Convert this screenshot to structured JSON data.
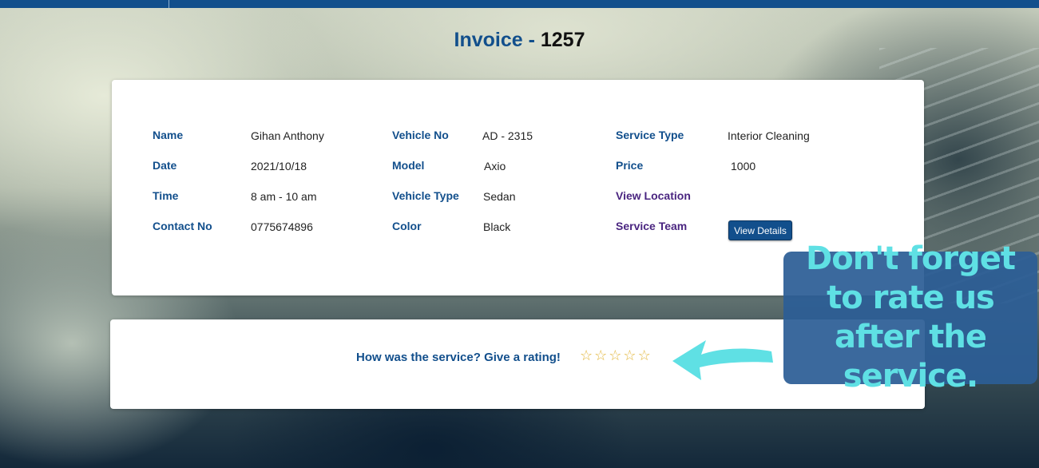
{
  "header": {
    "title_prefix": "Invoice - ",
    "invoice_number": "1257"
  },
  "details": {
    "name_label": "Name",
    "name_value": "Gihan Anthony",
    "date_label": "Date",
    "date_value": "2021/10/18",
    "time_label": "Time",
    "time_value": "8 am - 10 am",
    "contact_label": "Contact No",
    "contact_value": "0775674896",
    "vehicle_no_label": "Vehicle No",
    "vehicle_no_value": "AD - 2315",
    "model_label": "Model",
    "model_value": "Axio",
    "vehicle_type_label": "Vehicle Type",
    "vehicle_type_value": "Sedan",
    "color_label": "Color",
    "color_value": "Black",
    "service_type_label": "Service Type",
    "service_type_value": "Interior Cleaning",
    "price_label": "Price",
    "price_value": "1000",
    "view_location_label": "View Location",
    "service_team_label": "Service Team",
    "view_details_button": "View Details"
  },
  "rating": {
    "question": "How was the service? Give a rating!",
    "stars": [
      "☆",
      "☆",
      "☆",
      "☆",
      "☆"
    ],
    "star_color": "#e2b63a"
  },
  "callout": {
    "text": "Don't forget to rate us after the service.",
    "text_color": "#5fe0e4",
    "background": "#2c5e96",
    "arrow_color": "#5fe0e4"
  },
  "colors": {
    "primary": "#124f8c",
    "accent_purple": "#4a2580"
  }
}
